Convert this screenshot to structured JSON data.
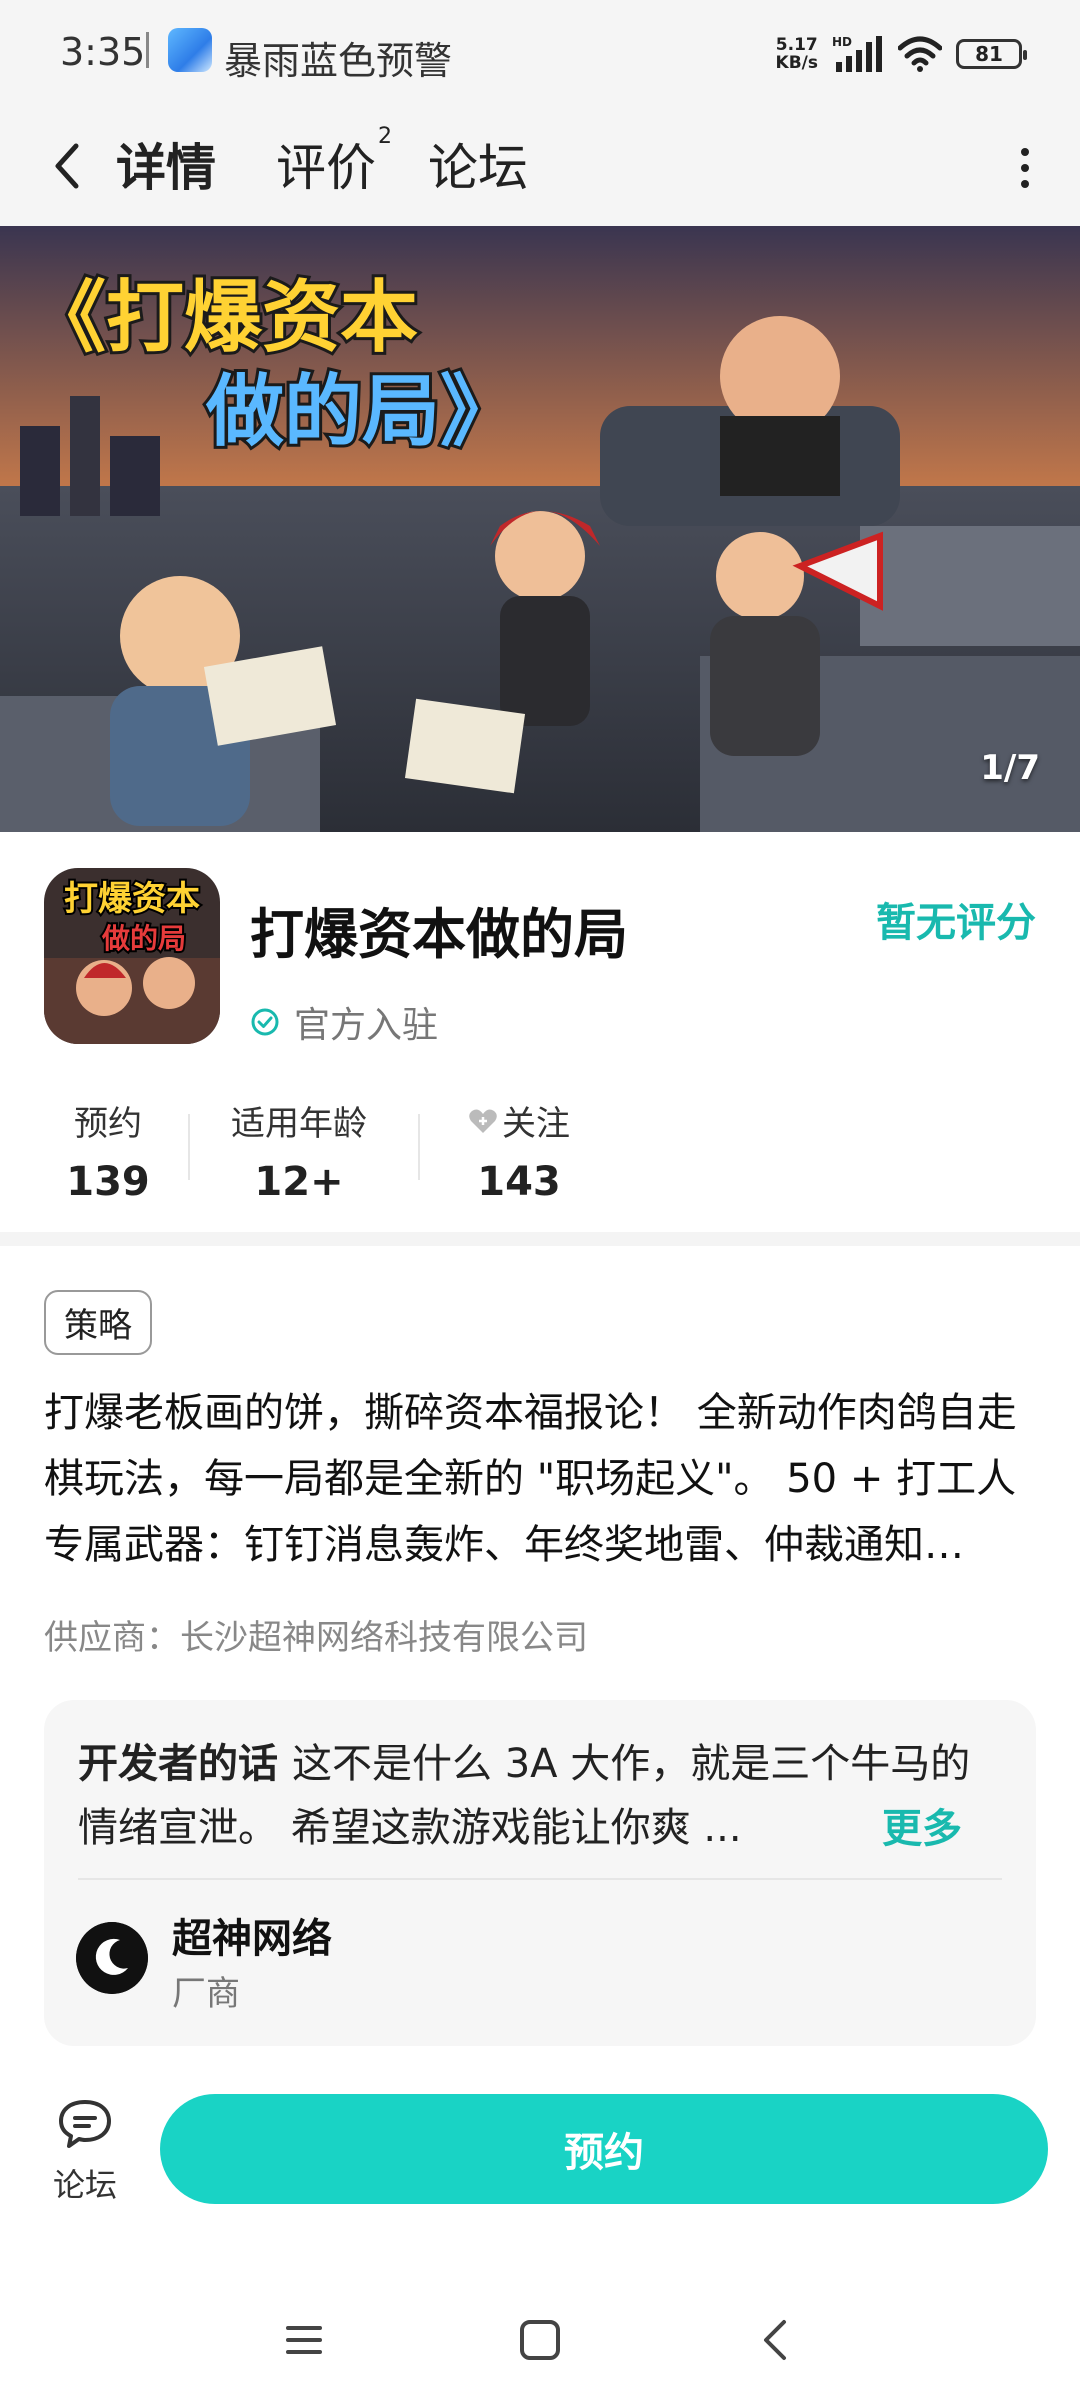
{
  "status_bar": {
    "time": "3:35",
    "notification": "暴雨蓝色预警",
    "net_speed_value": "5.17",
    "net_speed_unit": "KB/s",
    "hd": "HD",
    "battery": "81"
  },
  "nav": {
    "tabs": [
      {
        "label": "详情",
        "active": true
      },
      {
        "label": "评价",
        "badge": "2"
      },
      {
        "label": "论坛"
      }
    ]
  },
  "banner": {
    "title_line1": "《打爆资本",
    "title_line2": "做的局》",
    "counter": "1/7"
  },
  "app": {
    "name": "打爆资本做的局",
    "rating": "暂无评分",
    "official": "官方入驻",
    "icon_text_line1": "打爆资本",
    "icon_text_line2": "做的局"
  },
  "stats": [
    {
      "label": "预约",
      "value": "139"
    },
    {
      "label": "适用年龄",
      "value": "12+"
    },
    {
      "label": "关注",
      "value": "143"
    }
  ],
  "tag": "策略",
  "description": "打爆老板画的饼，撕碎资本福报论！ 全新动作肉鸽自走棋玩法，每一局都是全新的 \"职场起义\"。 50 + 打工人专属武器：钉钉消息轰炸、年终奖地雷、仲裁通知书……",
  "supplier": "供应商：长沙超神网络科技有限公司",
  "developer": {
    "title": "开发者的话",
    "words": "这不是什么 3A 大作，就是三个牛马的情绪宣泄。 希望这款游戏能让你爽 ...",
    "more": "更多",
    "name": "超神网络",
    "role": "厂商"
  },
  "actions": {
    "forum": "论坛",
    "reserve": "预约"
  },
  "colors": {
    "accent": "#19d3c5",
    "accent_text": "#19b9ae"
  }
}
